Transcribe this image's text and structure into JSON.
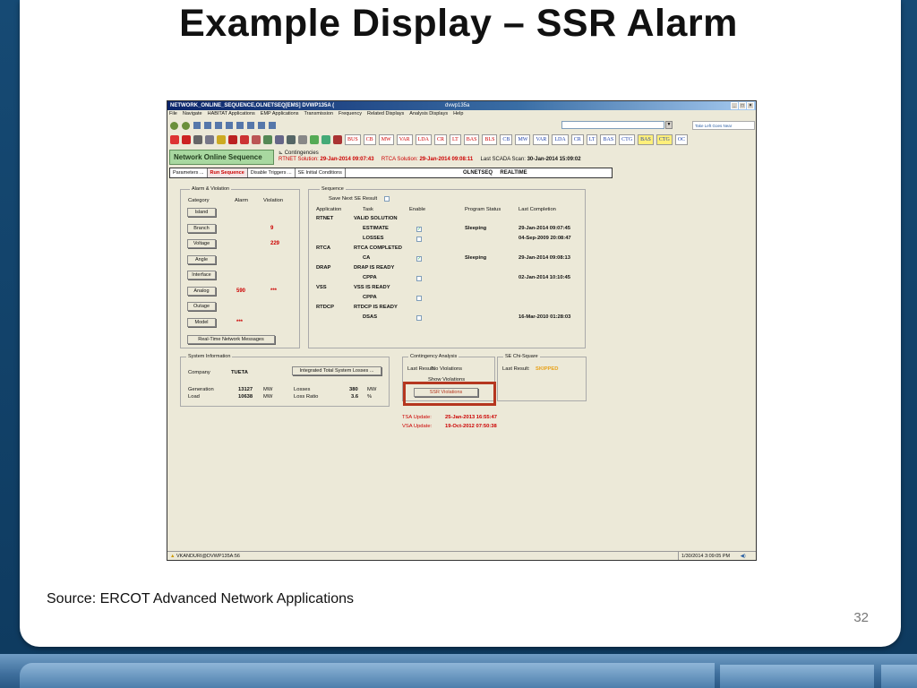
{
  "slide": {
    "title": "Example Display – SSR Alarm",
    "source": "Source: ERCOT Advanced Network Applications",
    "page_number": "32"
  },
  "window": {
    "title": "NETWORK_ONLINE_SEQUENCE,OLNETSEQ[EMS]   DVWP135A (",
    "title_mid": "dvwp135a",
    "menu": [
      "File",
      "Navigate",
      "HABITAT Applications",
      "EMP Applications",
      "Transmission",
      "Frequency",
      "Related Displays",
      "Analysis Displays",
      "Help"
    ],
    "logo_text": "Take Left Goes Near",
    "toolbar_tags": [
      "BUS",
      "CB",
      "MW",
      "VAR",
      "LDA",
      "CR",
      "LT",
      "BAS",
      "BLS",
      "CB",
      "MW",
      "VAR",
      "LDA",
      "CR",
      "LT",
      "BAS",
      "CTG",
      "BAS",
      "CTG",
      "OC"
    ]
  },
  "header": {
    "nos_button": "Network Online Sequence",
    "contingencies": "Contingencies",
    "rtnet_label": "RTNET Solution:",
    "rtnet_value": "29-Jan-2014 09:07:43",
    "rtca_label": "RTCA Solution:",
    "rtca_value": "29-Jan-2014 09:08:11",
    "scada_label": "Last SCADA Scan:",
    "scada_value": "30-Jan-2014 15:09:02"
  },
  "tabs": [
    "Parameters ...",
    "Run Sequence",
    "Disable Triggers ...",
    "SE Initial Conditions"
  ],
  "tab_right": {
    "name": "OLNETSEQ",
    "mode": "REALTIME"
  },
  "alarm": {
    "title": "Alarm & Violation",
    "headers": {
      "category": "Category",
      "alarm": "Alarm",
      "violation": "Violation"
    },
    "rows": [
      {
        "label": "Island",
        "alarm": "",
        "violation": ""
      },
      {
        "label": "Branch",
        "alarm": "",
        "violation": "9"
      },
      {
        "label": "Voltage",
        "alarm": "",
        "violation": "229"
      },
      {
        "label": "Angle",
        "alarm": "",
        "violation": ""
      },
      {
        "label": "Interface",
        "alarm": "",
        "violation": ""
      },
      {
        "label": "Analog",
        "alarm": "590",
        "violation": "***"
      },
      {
        "label": "Outage",
        "alarm": "",
        "violation": ""
      },
      {
        "label": "Model",
        "alarm": "***",
        "violation": ""
      }
    ],
    "rtnm_button": "Real-Time Network Messages"
  },
  "sequence": {
    "title": "Sequence",
    "save_label": "Save Next SE Result",
    "headers": {
      "application": "Application",
      "task": "Task",
      "enable": "Enable",
      "status": "Program Status",
      "completion": "Last Completion"
    },
    "rows": [
      {
        "app": "RTNET",
        "task": "VALID SOLUTION",
        "enable": "",
        "status": "",
        "completion": ""
      },
      {
        "app": "",
        "task": "ESTIMATE",
        "enable": "✓",
        "status": "Sleeping",
        "completion": "29-Jan-2014 09:07:45"
      },
      {
        "app": "",
        "task": "LOSSES",
        "enable": "",
        "status": "",
        "completion": "04-Sep-2009 20:08:47"
      },
      {
        "app": "RTCA",
        "task": "RTCA COMPLETED",
        "enable": "",
        "status": "",
        "completion": ""
      },
      {
        "app": "",
        "task": "CA",
        "enable": "✓",
        "status": "Sleeping",
        "completion": "29-Jan-2014 09:08:13"
      },
      {
        "app": "DRAP",
        "task": "DRAP IS READY",
        "enable": "",
        "status": "",
        "completion": ""
      },
      {
        "app": "",
        "task": "CPPA",
        "enable": "",
        "status": "",
        "completion": "02-Jan-2014 10:10:45"
      },
      {
        "app": "VSS",
        "task": "VSS IS READY",
        "enable": "",
        "status": "",
        "completion": ""
      },
      {
        "app": "",
        "task": "CPPA",
        "enable": "",
        "status": "",
        "completion": ""
      },
      {
        "app": "RTDCP",
        "task": "RTDCP IS READY",
        "enable": "",
        "status": "",
        "completion": ""
      },
      {
        "app": "",
        "task": "DSAS",
        "enable": "",
        "status": "",
        "completion": "16-Mar-2010 01:28:03"
      }
    ]
  },
  "sysinfo": {
    "title": "System Information",
    "company_label": "Company",
    "company_value": "TUETA",
    "itsl_button": "Integrated Total System Losses ...",
    "generation_label": "Generation",
    "generation_value": "13127",
    "load_label": "Load",
    "load_value": "10638",
    "mw": "MW",
    "losses_label": "Losses",
    "losses_value": "380",
    "ratio_label": "Loss Ratio",
    "ratio_value": "3.6",
    "pct": "%"
  },
  "contingency": {
    "title": "Contingency Analysis",
    "last_result_label": "Last Result:",
    "last_result_value": "No Violations",
    "show_violations": "Show Violations",
    "ssr_violations": "SSR Violations"
  },
  "chisq": {
    "title": "SE Chi-Square",
    "last_result_label": "Last Result:",
    "last_result_value": "SKIPPED"
  },
  "updates": {
    "tsa_label": "TSA Update:",
    "tsa_value": "25-Jan-2013 16:55:47",
    "vsa_label": "VSA Update:",
    "vsa_value": "19-Oct-2012 07:50:38"
  },
  "statusbar": {
    "user": "VKANDURI@DVWP135A:56",
    "time": "1/30/2014 3:09:05 PM"
  },
  "colors": {
    "accent_red": "#b5361f",
    "nos_green": "#a8d8a0",
    "slide_blue": "#0e3a5f"
  }
}
